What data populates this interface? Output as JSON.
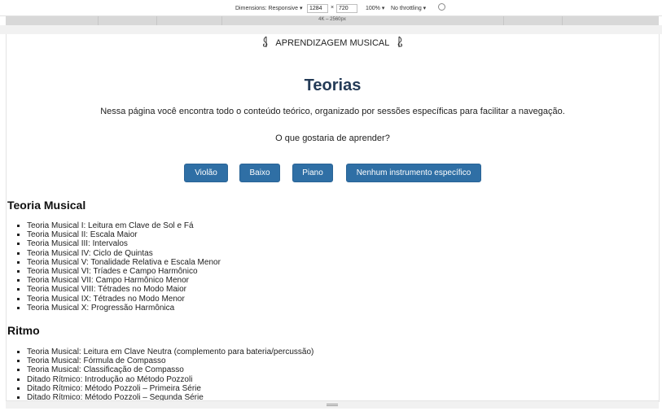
{
  "devtools": {
    "dimensions_label": "Dimensions: Responsive ▾",
    "width": "1284",
    "times": "×",
    "height": "720",
    "zoom": "100% ▾",
    "throttling": "No throttling ▾",
    "media_query": "4K – 2560px"
  },
  "site": {
    "brand": "APRENDIZAGEM MUSICAL"
  },
  "main": {
    "title": "Teorias",
    "intro": "Nessa página você encontra todo o conteúdo teórico, organizado por sessões específicas para facilitar a navegação.",
    "question": "O que gostaria de aprender?",
    "buttons": [
      "Violão",
      "Baixo",
      "Piano",
      "Nenhum instrumento específico"
    ]
  },
  "sections": [
    {
      "heading": "Teoria Musical",
      "items": [
        "Teoria Musical I: Leitura em Clave de Sol e Fá",
        "Teoria Musical II: Escala Maior",
        "Teoria Musical III: Intervalos",
        "Teoria Musical IV: Ciclo de Quintas",
        "Teoria Musical V: Tonalidade Relativa e Escala Menor",
        "Teoria Musical VI: Tríades e Campo Harmônico",
        "Teoria Musical VII: Campo Harmônico Menor",
        "Teoria Musical VIII: Tétrades no Modo Maior",
        "Teoria Musical IX: Tétrades no Modo Menor",
        "Teoria Musical X: Progressão Harmônica"
      ]
    },
    {
      "heading": "Ritmo",
      "items": [
        "Teoria Musical: Leitura em Clave Neutra (complemento para bateria/percussão)",
        "Teoria Musical: Fórmula de Compasso",
        "Teoria Musical: Classificação de Compasso",
        "Ditado Rítmico: Introdução ao Método Pozzoli",
        "Ditado Rítmico: Método Pozzoli – Primeira Série",
        "Ditado Rítmico: Método Pozzoli – Segunda Série"
      ]
    }
  ],
  "colors": {
    "title": "#243b57",
    "button": "#2f6fa5"
  }
}
